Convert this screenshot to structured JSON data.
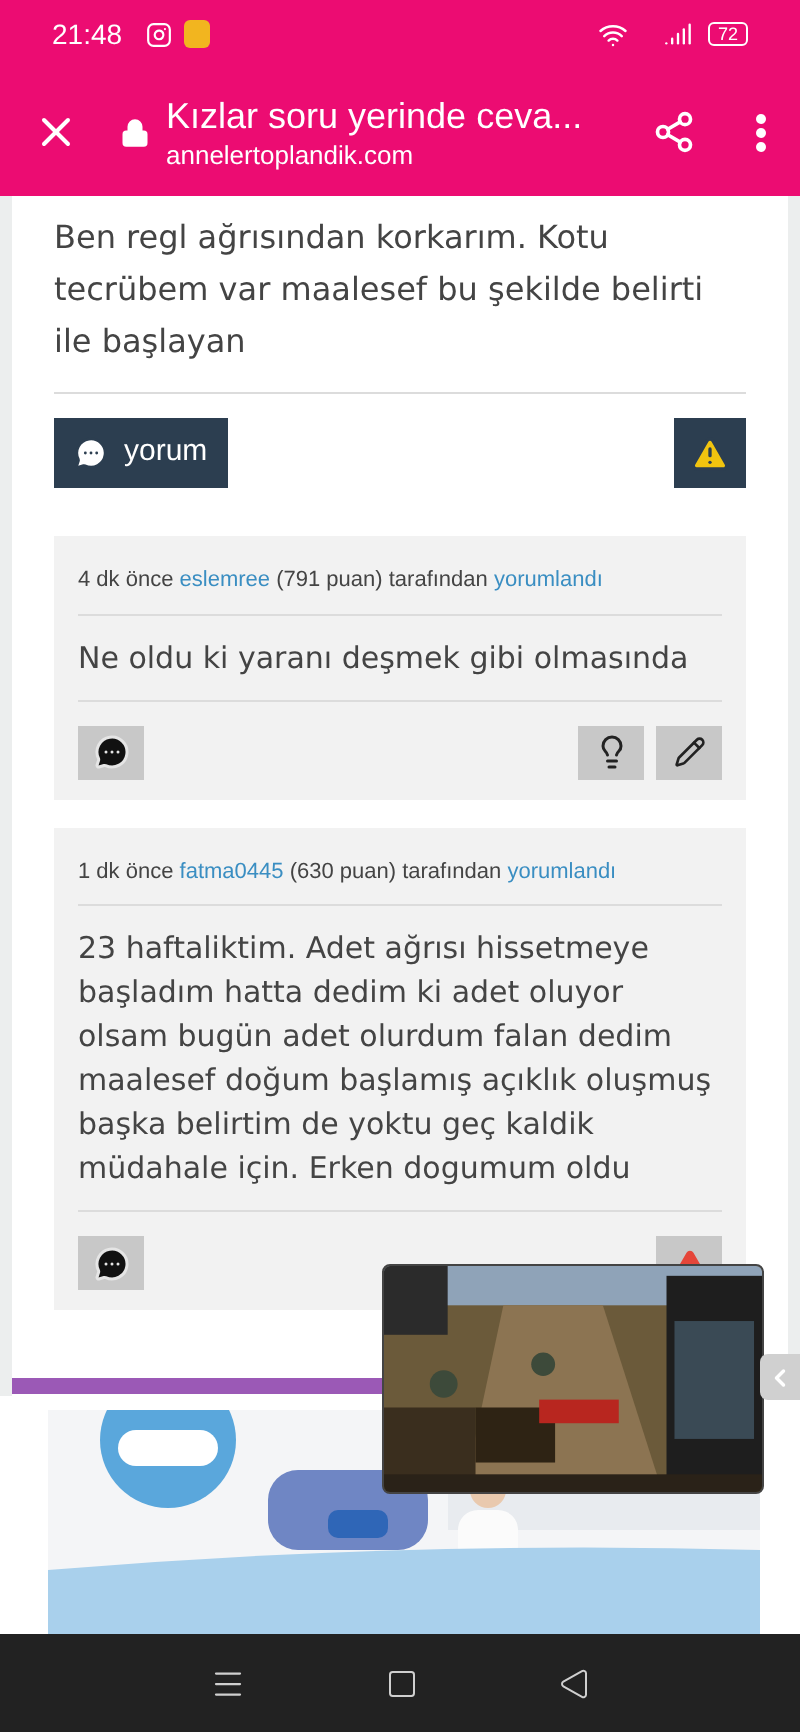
{
  "status_bar": {
    "time": "21:48",
    "battery": "72"
  },
  "header": {
    "title": "Kızlar soru yerinde ceva...",
    "url": "annelertoplandik.com"
  },
  "question": {
    "text": "Ben regl ağrısından korkarım. Kotu tecrübem var maalesef bu şekilde belirti ile başlayan",
    "comment_button": "yorum"
  },
  "comments": [
    {
      "time": "4 dk önce",
      "user": "eslemree",
      "points": "(791 puan)",
      "by": "tarafından",
      "action": "yorumlandı",
      "text": "Ne oldu ki yaranı deşmek gibi olmasında",
      "actions": [
        {
          "kind": "reply"
        },
        {
          "kind": "idea"
        },
        {
          "kind": "edit"
        }
      ]
    },
    {
      "time": "1 dk önce",
      "user": "fatma0445",
      "points": "(630 puan)",
      "by": "tarafından",
      "action": "yorumlandı",
      "text": "23 haftaliktim. Adet ağrısı hissetmeye başladım hatta dedim ki adet oluyor olsam bugün adet olurdum falan dedim maalesef doğum başlamış açıklık oluşmuş başka belirtim de yoktu geç kaldik müdahale için. Erken dogumum oldu",
      "actions": [
        {
          "kind": "reply"
        },
        {
          "kind": "report"
        }
      ]
    }
  ]
}
